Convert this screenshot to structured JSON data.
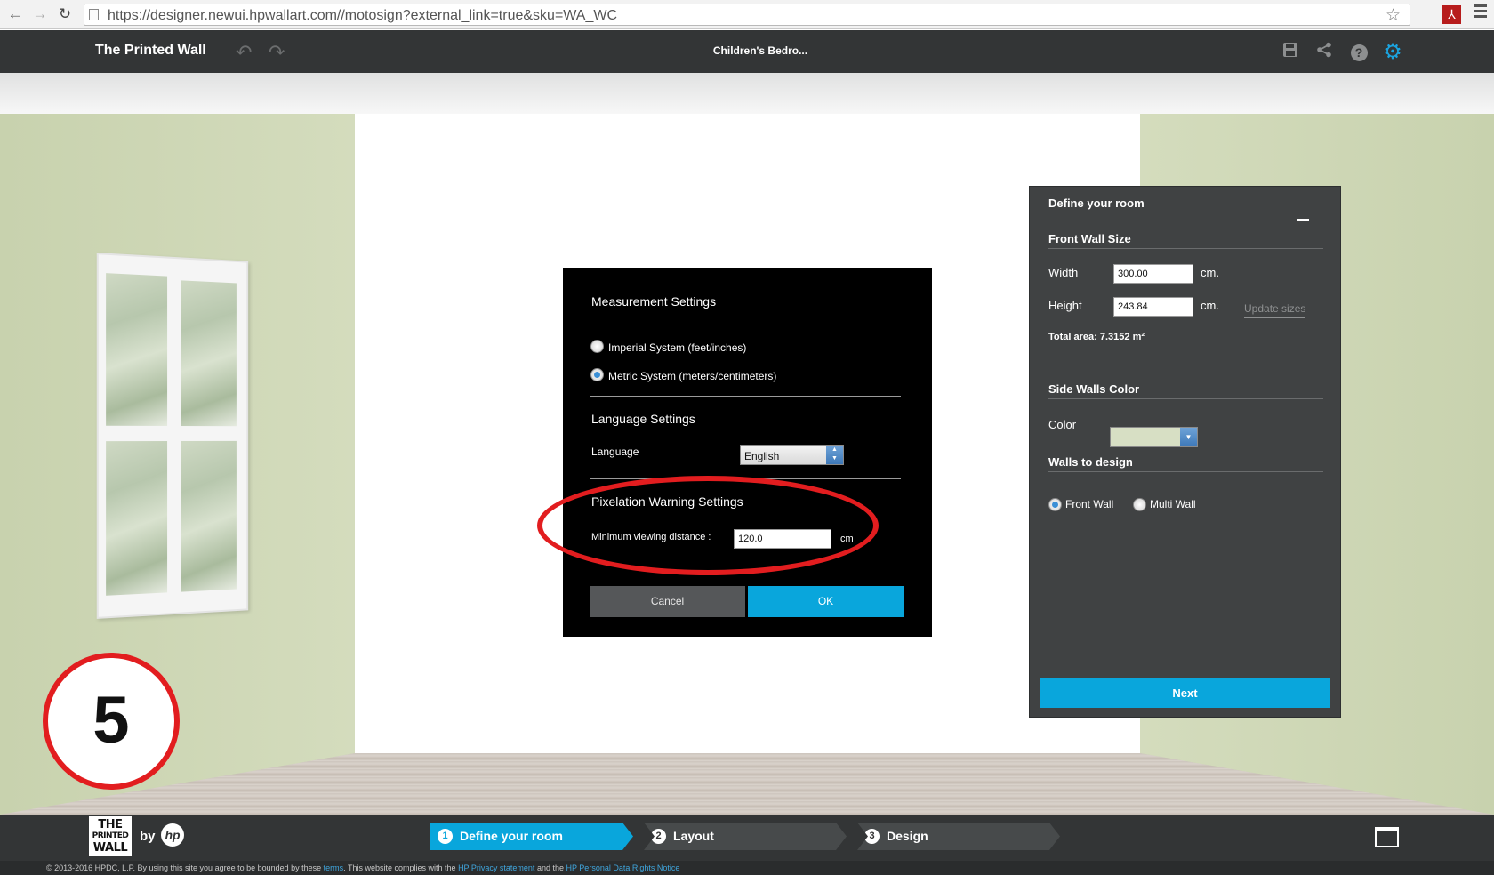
{
  "browser": {
    "url": "https://designer.newui.hpwallart.com//motosign?external_link=true&sku=WA_WC"
  },
  "header": {
    "app_title": "The Printed Wall",
    "document_title": "Children's Bedro..."
  },
  "step_badge": "5",
  "settings_dialog": {
    "measurement_heading": "Measurement Settings",
    "imperial_label": "Imperial System (feet/inches)",
    "metric_label": "Metric System (meters/centimeters)",
    "selected_system": "metric",
    "language_heading": "Language Settings",
    "language_label": "Language",
    "language_value": "English",
    "pixelation_heading": "Pixelation Warning Settings",
    "min_distance_label": "Minimum viewing distance :",
    "min_distance_value": "120.0",
    "min_distance_unit": "cm",
    "cancel_label": "Cancel",
    "ok_label": "OK"
  },
  "room_panel": {
    "title": "Define your room",
    "front_wall_heading": "Front Wall Size",
    "width_label": "Width",
    "width_value": "300.00",
    "height_label": "Height",
    "height_value": "243.84",
    "unit": "cm.",
    "update_sizes_label": "Update sizes",
    "total_area": "Total area: 7.3152 m²",
    "side_walls_heading": "Side Walls Color",
    "color_label": "Color",
    "side_wall_color": "#d7dfc4",
    "walls_to_design_heading": "Walls to design",
    "front_wall_label": "Front Wall",
    "multi_wall_label": "Multi Wall",
    "selected_wall": "front",
    "next_label": "Next"
  },
  "bottom_bar": {
    "logo_lines": [
      "THE",
      "PRINTED",
      "WALL"
    ],
    "by_label": "by",
    "hp_label": "hp",
    "steps": [
      {
        "num": "1",
        "label": "Define your room",
        "active": true
      },
      {
        "num": "2",
        "label": "Layout",
        "active": false
      },
      {
        "num": "3",
        "label": "Design",
        "active": false
      }
    ]
  },
  "footer": {
    "copyright": "© 2013-2016 HPDC, L.P.  By using this site you agree to be bounded by these ",
    "terms_link": "terms",
    "compliance": ". This website complies with the ",
    "privacy_link": "HP Privacy statement",
    "and_the": "  and the ",
    "data_rights_link": "HP Personal Data Rights Notice"
  },
  "colors": {
    "accent": "#09a6dc",
    "header_bg": "#333536",
    "annotation_red": "#e21d1f"
  }
}
